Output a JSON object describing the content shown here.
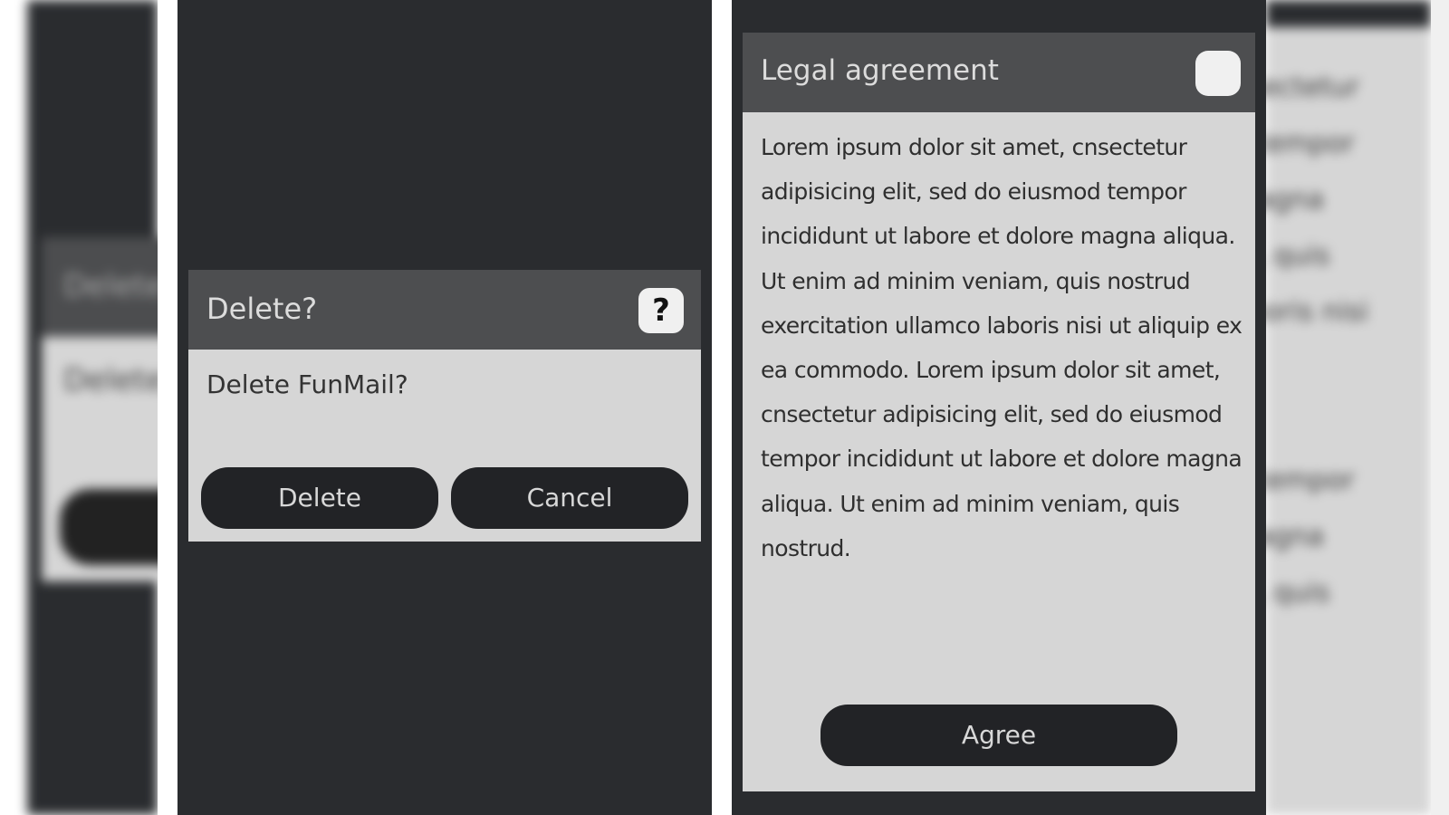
{
  "delete_dialog": {
    "title": "Delete?",
    "help_icon": "?",
    "message": "Delete FunMail?",
    "delete_label": "Delete",
    "cancel_label": "Cancel"
  },
  "legal_dialog": {
    "title": "Legal agreement",
    "body": "Lorem ipsum dolor sit amet, cnsectetur adipisicing elit, sed do eiusmod tempor incididunt ut labore et dolore magna aliqua. Ut enim ad minim veniam, quis nostrud exercitation ullamco laboris nisi ut aliquip ex ea commodo. Lorem ipsum dolor sit amet, cnsectetur adipisicing elit, sed do eiusmod tempor incididunt ut labore et dolore magna aliqua. Ut enim ad minim veniam, quis nostrud.",
    "agree_label": "Agree"
  },
  "left_blur_preview": {
    "title": "Delete",
    "message": "Delete"
  },
  "right_blur_preview": {
    "lines": "nsectetur\nd tempor\nmagna\nm, quis\naboris nisi\nm\n\nd tempor\nmagna\nm, quis"
  },
  "colors": {
    "screen_background": "#2a2c2f",
    "dialog_header": "#4d4e50",
    "dialog_body": "#d6d6d6",
    "button": "#222326"
  },
  "icons": {
    "help": "question-icon",
    "legal_header": "rounded-square-icon"
  }
}
